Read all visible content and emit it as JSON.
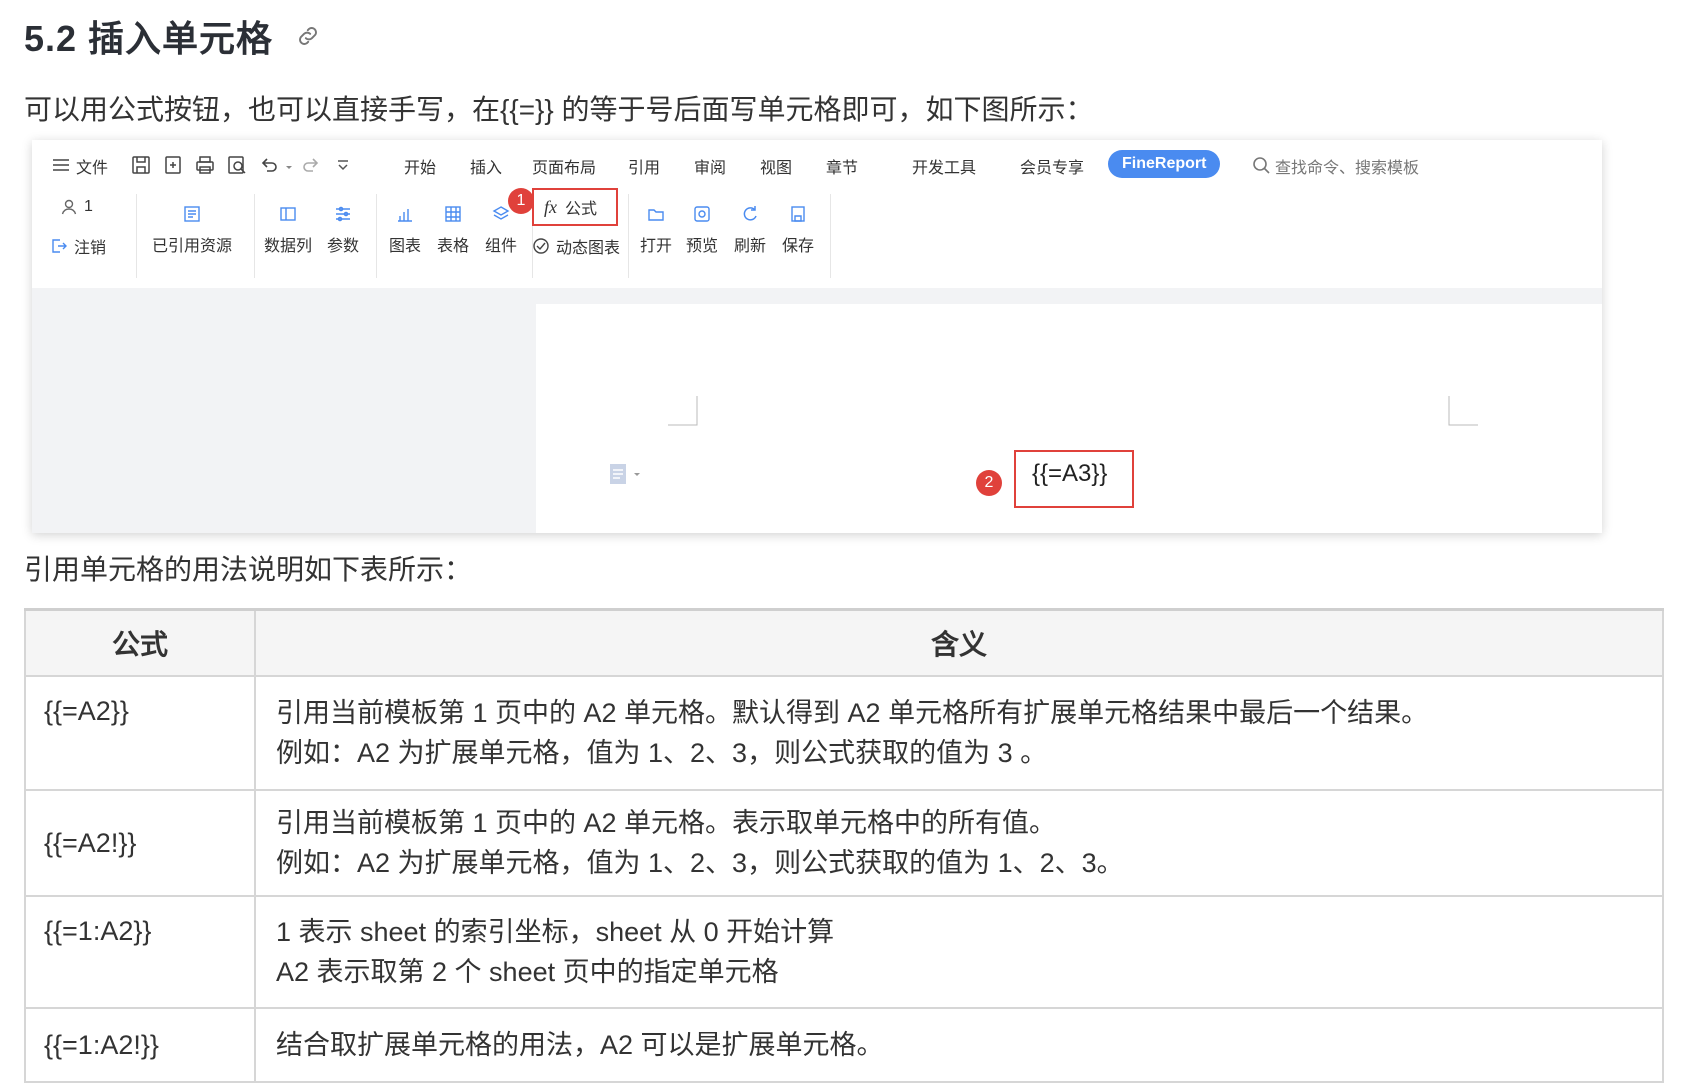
{
  "heading": {
    "title": "5.2 插入单元格",
    "link_icon": "link-icon"
  },
  "intro": "可以用公式按钮，也可以直接手写，在{{=}} 的等于号后面写单元格即可，如下图所示：",
  "screenshot": {
    "menubar": {
      "file": "文件",
      "items": [
        "开始",
        "插入",
        "页面布局",
        "引用",
        "审阅",
        "视图",
        "章节",
        "开发工具",
        "会员专享"
      ],
      "brand": "FineReport",
      "search": "查找命令、搜索模板"
    },
    "ribbon": {
      "user_count": "1",
      "logout": "注销",
      "referenced": "已引用资源",
      "data_column": "数据列",
      "params": "参数",
      "chart": "图表",
      "table": "表格",
      "component": "组件",
      "formula": "公式",
      "dynamic_chart": "动态图表",
      "open": "打开",
      "preview": "预览",
      "refresh": "刷新",
      "save": "保存"
    },
    "badge1": "1",
    "badge2": "2",
    "cell_formula": "{{=A3}}",
    "colors": {
      "highlight": "#e0413b",
      "brand": "#4a8bf0"
    }
  },
  "para2": "引用单元格的用法说明如下表所示：",
  "table": {
    "headers": [
      "公式",
      "含义"
    ],
    "rows": [
      {
        "formula": "{{=A2}}",
        "line1": "引用当前模板第 1 页中的 A2 单元格。默认得到 A2 单元格所有扩展单元格结果中最后一个结果。",
        "line2": "例如：A2 为扩展单元格，值为 1、2、3，则公式获取的值为 3 。"
      },
      {
        "formula": "{{=A2!}}",
        "line1": "引用当前模板第 1 页中的 A2 单元格。表示取单元格中的所有值。",
        "line2": "例如：A2 为扩展单元格，值为 1、2、3，则公式获取的值为 1、2、3。"
      },
      {
        "formula": "{{=1:A2}}",
        "line1": "1 表示 sheet 的索引坐标，sheet 从 0 开始计算",
        "line2": "A2 表示取第 2 个 sheet 页中的指定单元格"
      },
      {
        "formula": "{{=1:A2!}}",
        "line1": "结合取扩展单元格的用法，A2 可以是扩展单元格。"
      }
    ]
  }
}
